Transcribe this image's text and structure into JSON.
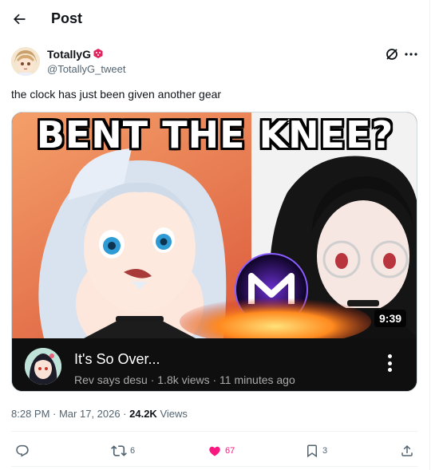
{
  "header": {
    "title": "Post",
    "back_icon": "arrow-left-icon"
  },
  "author": {
    "name": "TotallyG",
    "handle": "@TotallyG_tweet",
    "badge_icon": "red-dice-icon",
    "grok_icon": "grok-icon",
    "more_icon": "more-dots-icon"
  },
  "tweet": {
    "text": "the clock has just been given another gear"
  },
  "video": {
    "thumbnail_text": "BENT THE KNEE?",
    "duration": "9:39",
    "title": "It's So Over...",
    "meta": "Rev says desu · 1.8k views · 11 minutes ago",
    "menu_icon": "vertical-dots-icon"
  },
  "timestamp": {
    "time": "8:28 PM · Mar 17, 2026 · ",
    "views_count": "24.2K",
    "views_label": " Views"
  },
  "actions": {
    "reply": {
      "icon": "reply-icon",
      "count": ""
    },
    "retweet": {
      "icon": "retweet-icon",
      "count": "6"
    },
    "like": {
      "icon": "heart-icon",
      "count": "67",
      "color": "#f91880"
    },
    "bookmark": {
      "icon": "bookmark-icon",
      "count": "3"
    },
    "share": {
      "icon": "share-icon",
      "count": ""
    }
  },
  "colors": {
    "text": "#0f1419",
    "secondary": "#536471",
    "like": "#f91880",
    "border": "#eff3f4"
  }
}
